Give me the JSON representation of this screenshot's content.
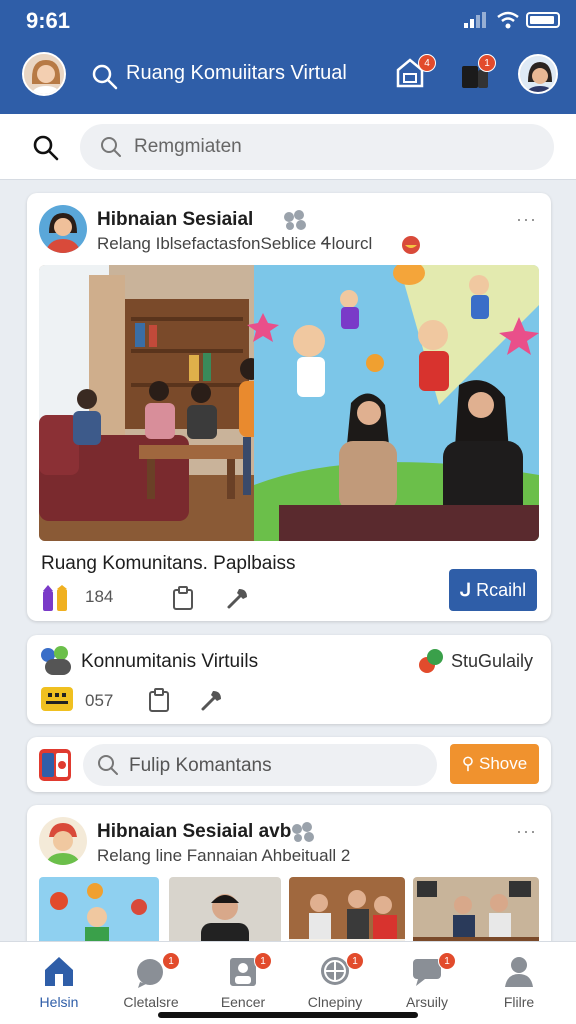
{
  "status": {
    "time": "9:61"
  },
  "header": {
    "title": "Ruang Komuiitars Virtual",
    "notification_badge": "4",
    "device_badge": "1",
    "colors": {
      "bar": "#2f5ea8",
      "badge": "#e24b2c"
    }
  },
  "search": {
    "placeholder": "Remgmiaten"
  },
  "feed": {
    "post1": {
      "title": "Hibnaian Sesiaial",
      "subtitle": "Relang IblsefactasfonSeblice Ꮞlourcl",
      "more": "···",
      "caption": "Ruang Komunitans. Paplbaiss",
      "count": "184",
      "join_label": "Rcaihl",
      "image": "community-room-illustration"
    },
    "post2": {
      "title": "Konnumitanis Virtuils",
      "right_label": "StuGulaily",
      "count": "057"
    },
    "search_card": {
      "placeholder": "Fulip Komantans",
      "button_label": "Shove"
    },
    "post3": {
      "title": "Hibnaian Sesiaial avb",
      "subtitle": "Relang line Fannaian Ahbeituall 2",
      "more": "···"
    }
  },
  "nav": {
    "items": [
      {
        "label": "Helsin",
        "icon": "home-icon",
        "active": true
      },
      {
        "label": "Cletalsre",
        "icon": "chat-icon",
        "badge": "1"
      },
      {
        "label": "Eencer",
        "icon": "group-icon",
        "badge": "1"
      },
      {
        "label": "Clnepiny",
        "icon": "globe-icon",
        "badge": "1"
      },
      {
        "label": "Arsuily",
        "icon": "message-icon",
        "badge": "1"
      },
      {
        "label": "Flilre",
        "icon": "profile-icon"
      }
    ]
  }
}
